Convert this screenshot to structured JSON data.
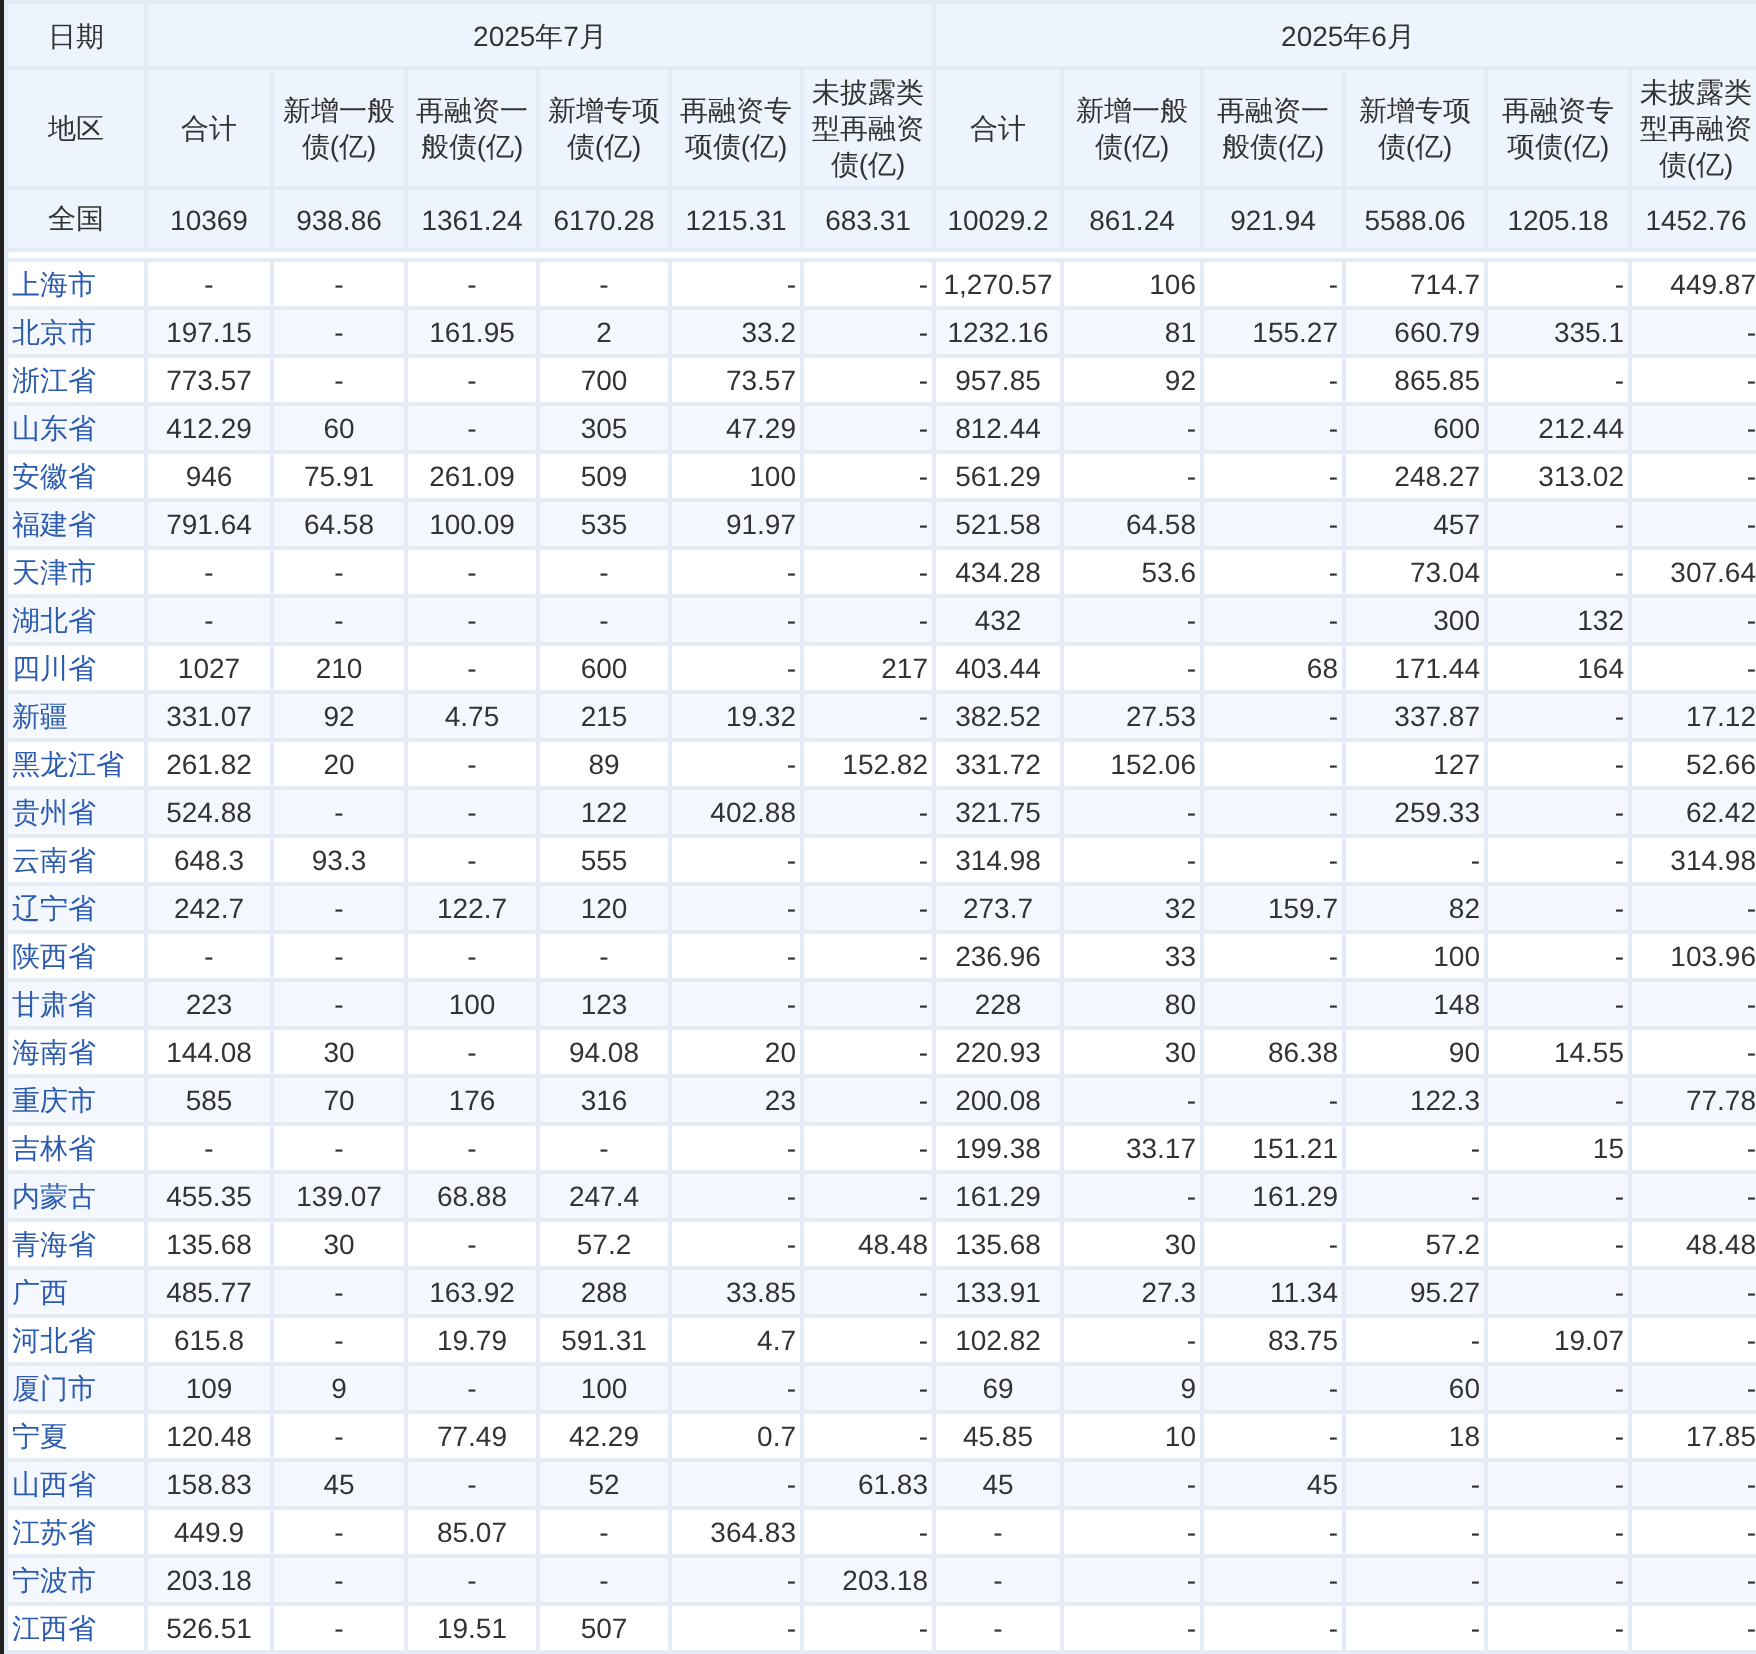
{
  "table": {
    "corner_header": "日期",
    "groups": [
      "2025年7月",
      "2025年6月"
    ],
    "region_header": "地区",
    "columns": [
      [
        "合计",
        "新增一般债(亿)",
        "再融资一般债(亿)",
        "新增专项债(亿)",
        "再融资专项债(亿)",
        "未披露类型再融资债(亿)"
      ],
      [
        "合计",
        "新增一般债(亿)",
        "再融资一般债(亿)",
        "新增专项债(亿)",
        "再融资专项债(亿)",
        "未披露类型再融资债(亿)"
      ]
    ],
    "total": {
      "region": "全国",
      "values": [
        "10369",
        "938.86",
        "1361.24",
        "6170.28",
        "1215.31",
        "683.31",
        "10029.2",
        "861.24",
        "921.94",
        "5588.06",
        "1205.18",
        "1452.76"
      ]
    },
    "rows": [
      {
        "region": "上海市",
        "values": [
          "-",
          "-",
          "-",
          "-",
          "-",
          "-",
          "1,270.57",
          "106",
          "-",
          "714.7",
          "-",
          "449.87"
        ]
      },
      {
        "region": "北京市",
        "values": [
          "197.15",
          "-",
          "161.95",
          "2",
          "33.2",
          "-",
          "1232.16",
          "81",
          "155.27",
          "660.79",
          "335.1",
          "-"
        ]
      },
      {
        "region": "浙江省",
        "values": [
          "773.57",
          "-",
          "-",
          "700",
          "73.57",
          "-",
          "957.85",
          "92",
          "-",
          "865.85",
          "-",
          "-"
        ]
      },
      {
        "region": "山东省",
        "values": [
          "412.29",
          "60",
          "-",
          "305",
          "47.29",
          "-",
          "812.44",
          "-",
          "-",
          "600",
          "212.44",
          "-"
        ]
      },
      {
        "region": "安徽省",
        "values": [
          "946",
          "75.91",
          "261.09",
          "509",
          "100",
          "-",
          "561.29",
          "-",
          "-",
          "248.27",
          "313.02",
          "-"
        ]
      },
      {
        "region": "福建省",
        "values": [
          "791.64",
          "64.58",
          "100.09",
          "535",
          "91.97",
          "-",
          "521.58",
          "64.58",
          "-",
          "457",
          "-",
          "-"
        ]
      },
      {
        "region": "天津市",
        "values": [
          "-",
          "-",
          "-",
          "-",
          "-",
          "-",
          "434.28",
          "53.6",
          "-",
          "73.04",
          "-",
          "307.64"
        ]
      },
      {
        "region": "湖北省",
        "values": [
          "-",
          "-",
          "-",
          "-",
          "-",
          "-",
          "432",
          "-",
          "-",
          "300",
          "132",
          "-"
        ]
      },
      {
        "region": "四川省",
        "values": [
          "1027",
          "210",
          "-",
          "600",
          "-",
          "217",
          "403.44",
          "-",
          "68",
          "171.44",
          "164",
          "-"
        ]
      },
      {
        "region": "新疆",
        "values": [
          "331.07",
          "92",
          "4.75",
          "215",
          "19.32",
          "-",
          "382.52",
          "27.53",
          "-",
          "337.87",
          "-",
          "17.12"
        ]
      },
      {
        "region": "黑龙江省",
        "values": [
          "261.82",
          "20",
          "-",
          "89",
          "-",
          "152.82",
          "331.72",
          "152.06",
          "-",
          "127",
          "-",
          "52.66"
        ]
      },
      {
        "region": "贵州省",
        "values": [
          "524.88",
          "-",
          "-",
          "122",
          "402.88",
          "-",
          "321.75",
          "-",
          "-",
          "259.33",
          "-",
          "62.42"
        ]
      },
      {
        "region": "云南省",
        "values": [
          "648.3",
          "93.3",
          "-",
          "555",
          "-",
          "-",
          "314.98",
          "-",
          "-",
          "-",
          "-",
          "314.98"
        ]
      },
      {
        "region": "辽宁省",
        "values": [
          "242.7",
          "-",
          "122.7",
          "120",
          "-",
          "-",
          "273.7",
          "32",
          "159.7",
          "82",
          "-",
          "-"
        ]
      },
      {
        "region": "陕西省",
        "values": [
          "-",
          "-",
          "-",
          "-",
          "-",
          "-",
          "236.96",
          "33",
          "-",
          "100",
          "-",
          "103.96"
        ]
      },
      {
        "region": "甘肃省",
        "values": [
          "223",
          "-",
          "100",
          "123",
          "-",
          "-",
          "228",
          "80",
          "-",
          "148",
          "-",
          "-"
        ]
      },
      {
        "region": "海南省",
        "values": [
          "144.08",
          "30",
          "-",
          "94.08",
          "20",
          "-",
          "220.93",
          "30",
          "86.38",
          "90",
          "14.55",
          "-"
        ]
      },
      {
        "region": "重庆市",
        "values": [
          "585",
          "70",
          "176",
          "316",
          "23",
          "-",
          "200.08",
          "-",
          "-",
          "122.3",
          "-",
          "77.78"
        ]
      },
      {
        "region": "吉林省",
        "values": [
          "-",
          "-",
          "-",
          "-",
          "-",
          "-",
          "199.38",
          "33.17",
          "151.21",
          "-",
          "15",
          "-"
        ]
      },
      {
        "region": "内蒙古",
        "values": [
          "455.35",
          "139.07",
          "68.88",
          "247.4",
          "-",
          "-",
          "161.29",
          "-",
          "161.29",
          "-",
          "-",
          "-"
        ]
      },
      {
        "region": "青海省",
        "values": [
          "135.68",
          "30",
          "-",
          "57.2",
          "-",
          "48.48",
          "135.68",
          "30",
          "-",
          "57.2",
          "-",
          "48.48"
        ]
      },
      {
        "region": "广西",
        "values": [
          "485.77",
          "-",
          "163.92",
          "288",
          "33.85",
          "-",
          "133.91",
          "27.3",
          "11.34",
          "95.27",
          "-",
          "-"
        ]
      },
      {
        "region": "河北省",
        "values": [
          "615.8",
          "-",
          "19.79",
          "591.31",
          "4.7",
          "-",
          "102.82",
          "-",
          "83.75",
          "-",
          "19.07",
          "-"
        ]
      },
      {
        "region": "厦门市",
        "values": [
          "109",
          "9",
          "-",
          "100",
          "-",
          "-",
          "69",
          "9",
          "-",
          "60",
          "-",
          "-"
        ]
      },
      {
        "region": "宁夏",
        "values": [
          "120.48",
          "-",
          "77.49",
          "42.29",
          "0.7",
          "-",
          "45.85",
          "10",
          "-",
          "18",
          "-",
          "17.85"
        ]
      },
      {
        "region": "山西省",
        "values": [
          "158.83",
          "45",
          "-",
          "52",
          "-",
          "61.83",
          "45",
          "-",
          "45",
          "-",
          "-",
          "-"
        ]
      },
      {
        "region": "江苏省",
        "values": [
          "449.9",
          "-",
          "85.07",
          "-",
          "364.83",
          "-",
          "-",
          "-",
          "-",
          "-",
          "-",
          "-"
        ]
      },
      {
        "region": "宁波市",
        "values": [
          "203.18",
          "-",
          "-",
          "-",
          "-",
          "203.18",
          "-",
          "-",
          "-",
          "-",
          "-",
          "-"
        ]
      },
      {
        "region": "江西省",
        "values": [
          "526.51",
          "-",
          "19.51",
          "507",
          "-",
          "-",
          "-",
          "-",
          "-",
          "-",
          "-",
          "-"
        ]
      }
    ]
  }
}
